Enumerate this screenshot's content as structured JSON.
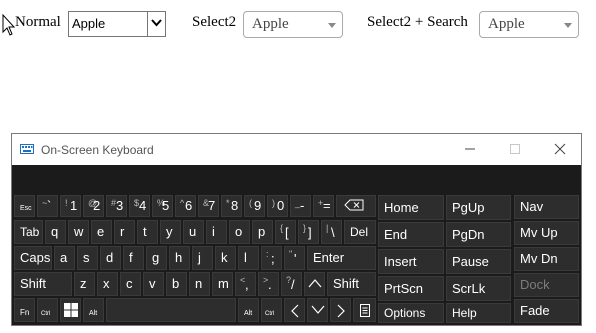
{
  "form": {
    "normal_label": "Normal",
    "normal_value": "Apple",
    "select2_label": "Select2",
    "select2_value": "Apple",
    "select2_search_label": "Select2 + Search",
    "select2_search_value": "Apple"
  },
  "osk": {
    "title": "On-Screen Keyboard",
    "rows": [
      [
        "Esc",
        [
          "~",
          "`"
        ],
        [
          "!",
          "1"
        ],
        [
          "@",
          "2"
        ],
        [
          "#",
          "3"
        ],
        [
          "$",
          "4"
        ],
        [
          "%",
          "5"
        ],
        [
          "^",
          "6"
        ],
        [
          "&",
          "7"
        ],
        [
          "*",
          "8"
        ],
        [
          "(",
          "9"
        ],
        [
          ")",
          "0"
        ],
        [
          "_",
          "-"
        ],
        [
          "+",
          "="
        ],
        "backspace-icon"
      ],
      [
        "Tab",
        "q",
        "w",
        "e",
        "r",
        "t",
        "y",
        "u",
        "i",
        "o",
        "p",
        [
          "{",
          "["
        ],
        [
          "}",
          "]"
        ],
        [
          "|",
          "\\"
        ],
        "Del"
      ],
      [
        "Caps",
        "a",
        "s",
        "d",
        "f",
        "g",
        "h",
        "j",
        "k",
        "l",
        [
          ":",
          ";"
        ],
        [
          "\"",
          "'"
        ],
        "Enter"
      ],
      [
        "Shift",
        "z",
        "x",
        "c",
        "v",
        "b",
        "n",
        "m",
        [
          "<",
          ","
        ],
        [
          ">",
          "."
        ],
        [
          "?",
          "/"
        ],
        "up-arrow-icon",
        "Shift"
      ],
      [
        "Fn",
        "Ctrl",
        "windows-icon",
        "Alt",
        "Alt",
        "Ctrl",
        "left-arrow-icon",
        "down-arrow-icon",
        "right-arrow-icon",
        "context-menu-icon"
      ]
    ],
    "nav_keys": [
      "Home",
      "PgUp",
      "End",
      "PgDn",
      "Insert",
      "Pause",
      "PrtScn",
      "ScrLk",
      "Options",
      "Help"
    ],
    "side_keys": [
      "Nav",
      "Mv Up",
      "Mv Dn",
      "Dock",
      "Fade"
    ]
  }
}
